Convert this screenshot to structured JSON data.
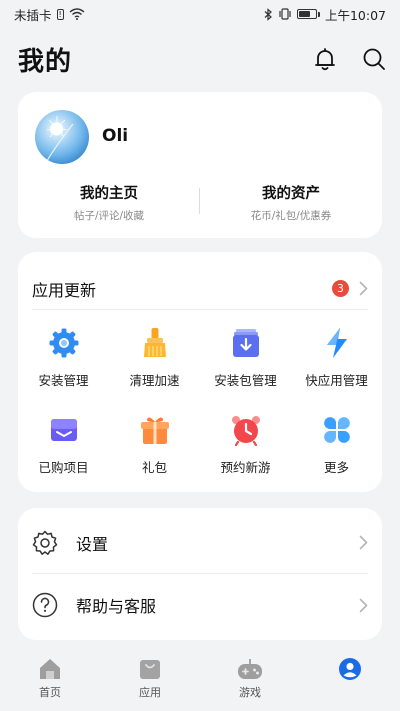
{
  "status_bar": {
    "carrier": "未插卡",
    "time": "上午10:07"
  },
  "header": {
    "title": "我的"
  },
  "profile": {
    "user_name": "Oli",
    "homepage_title": "我的主页",
    "homepage_sub": "帖子/评论/收藏",
    "assets_title": "我的资产",
    "assets_sub": "花币/礼包/优惠券"
  },
  "apps": {
    "title": "应用更新",
    "badge_count": "3",
    "items": [
      {
        "label": "安装管理",
        "icon": "gear-icon"
      },
      {
        "label": "清理加速",
        "icon": "broom-icon"
      },
      {
        "label": "安装包管理",
        "icon": "package-download-icon"
      },
      {
        "label": "快应用管理",
        "icon": "lightning-icon"
      },
      {
        "label": "已购项目",
        "icon": "purchased-icon"
      },
      {
        "label": "礼包",
        "icon": "gift-icon"
      },
      {
        "label": "预约新游",
        "icon": "alarm-clock-icon"
      },
      {
        "label": "更多",
        "icon": "more-petals-icon"
      }
    ]
  },
  "settings": {
    "settings_label": "设置",
    "help_label": "帮助与客服"
  },
  "nav": {
    "items": [
      {
        "label": "首页",
        "icon": "home-icon"
      },
      {
        "label": "应用",
        "icon": "app-bag-icon"
      },
      {
        "label": "游戏",
        "icon": "gamepad-icon"
      },
      {
        "label": "",
        "icon": "profile-icon"
      }
    ]
  },
  "colors": {
    "accent": "#1a6ce6",
    "badge": "#e94b3c",
    "background": "#f1f3f5"
  }
}
